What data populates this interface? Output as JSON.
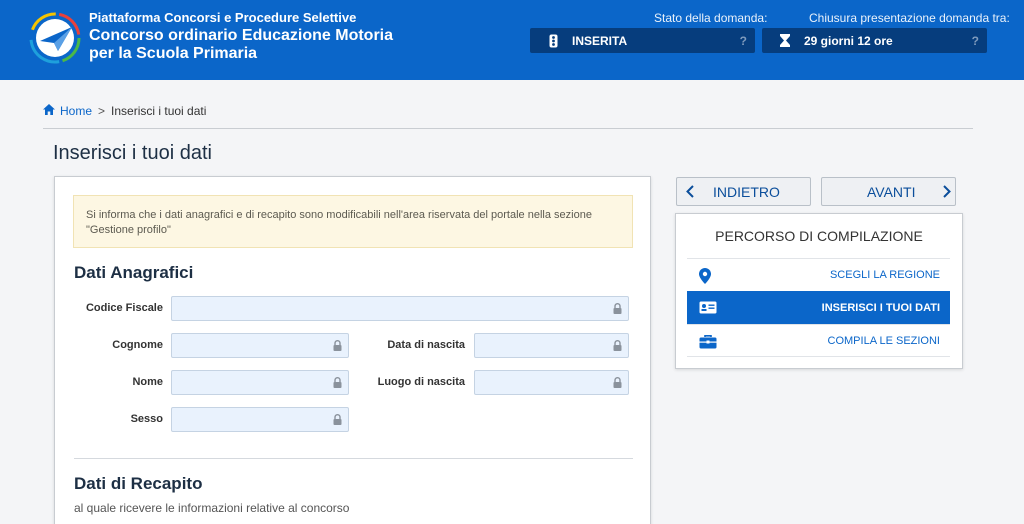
{
  "header": {
    "platform": "Piattaforma Concorsi e Procedure Selettive",
    "title": "Concorso ordinario Educazione Motoria per la Scuola Primaria",
    "status_label": "Stato della domanda:",
    "status_value": "INSERITA",
    "deadline_label": "Chiusura presentazione domanda tra:",
    "deadline_value": "29 giorni 12 ore",
    "help_mark": "?",
    "icons": [
      "logo",
      "traffic-light-icon",
      "hourglass-icon",
      "help-icon"
    ]
  },
  "breadcrumb": {
    "home": "Home",
    "separator": ">",
    "current": "Inserisci i tuoi dati"
  },
  "page_title": "Inserisci i tuoi dati",
  "notice": "Si informa che i dati anagrafici e di recapito sono modificabili nell'area riservata del portale nella sezione \"Gestione profilo\"",
  "anagrafici": {
    "title": "Dati Anagrafici",
    "codice_fiscale": {
      "label": "Codice Fiscale",
      "value": ""
    },
    "cognome": {
      "label": "Cognome",
      "value": ""
    },
    "data_nascita": {
      "label": "Data di nascita",
      "value": ""
    },
    "nome": {
      "label": "Nome",
      "value": ""
    },
    "luogo_nascita": {
      "label": "Luogo di nascita",
      "value": ""
    },
    "sesso": {
      "label": "Sesso",
      "value": ""
    }
  },
  "recapito": {
    "title": "Dati di Recapito",
    "subtitle": "al quale ricevere le informazioni relative al concorso"
  },
  "nav": {
    "back": "INDIETRO",
    "next": "AVANTI"
  },
  "percorso": {
    "title": "PERCORSO DI COMPILAZIONE",
    "steps": [
      {
        "label": "SCEGLI LA REGIONE",
        "icon": "map-pin-icon",
        "active": false
      },
      {
        "label": "INSERISCI I TUOI DATI",
        "icon": "id-card-icon",
        "active": true
      },
      {
        "label": "COMPILA LE SEZIONI",
        "icon": "briefcase-icon",
        "active": false
      }
    ]
  },
  "colors": {
    "header_bg": "#0b66c9",
    "status_box_bg": "#063d7d",
    "accent": "#0b66c9",
    "field_bg": "#e9f2fd",
    "notice_bg": "#fdf7e3"
  }
}
